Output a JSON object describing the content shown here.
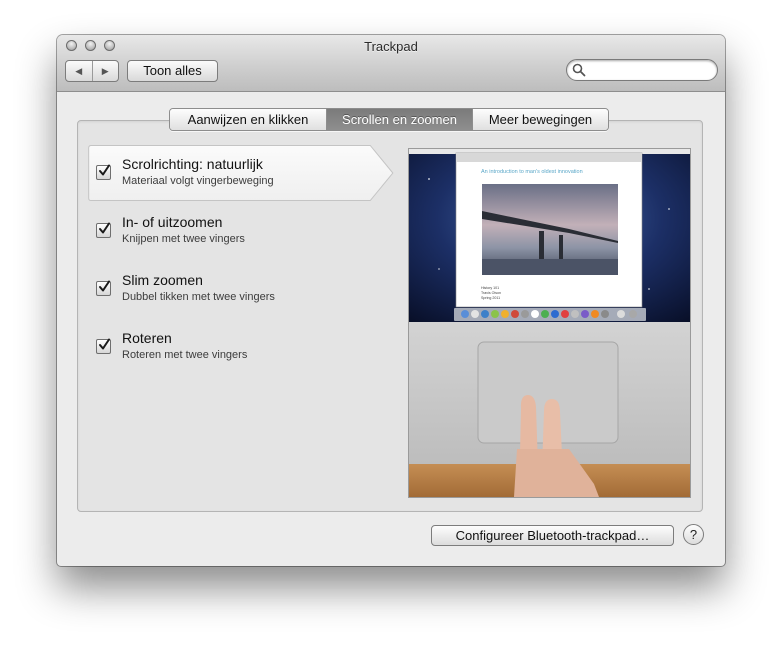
{
  "window": {
    "title": "Trackpad",
    "show_all_label": "Toon alles",
    "nav_back_glyph": "◀",
    "nav_forward_glyph": "▶"
  },
  "search": {
    "placeholder": ""
  },
  "tabs": [
    {
      "label": "Aanwijzen en klikken",
      "active": false
    },
    {
      "label": "Scrollen en zoomen",
      "active": true
    },
    {
      "label": "Meer bewegingen",
      "active": false
    }
  ],
  "options": [
    {
      "title": "Scrolrichting: natuurlijk",
      "subtitle": "Materiaal volgt vingerbeweging",
      "checked": true,
      "selected": true
    },
    {
      "title": "In- of uitzoomen",
      "subtitle": "Knijpen met twee vingers",
      "checked": true,
      "selected": false
    },
    {
      "title": "Slim zoomen",
      "subtitle": "Dubbel tikken met twee vingers",
      "checked": true,
      "selected": false
    },
    {
      "title": "Roteren",
      "subtitle": "Roteren met twee vingers",
      "checked": true,
      "selected": false
    }
  ],
  "preview": {
    "doc_heading": "An introduction to man's oldest innovation",
    "doc_caption_lines": [
      "History 101",
      "Travis Olson",
      "Spring 2011"
    ]
  },
  "footer": {
    "bluetooth_button_label": "Configureer Bluetooth-trackpad…",
    "help_label": "?"
  },
  "colors": {
    "active_tab": "#838383",
    "window_bg": "#ececec",
    "doc_heading": "#5aa7c8"
  },
  "icons": {
    "search": "search-icon",
    "checkbox": "checkmark-icon",
    "help": "help-icon"
  }
}
